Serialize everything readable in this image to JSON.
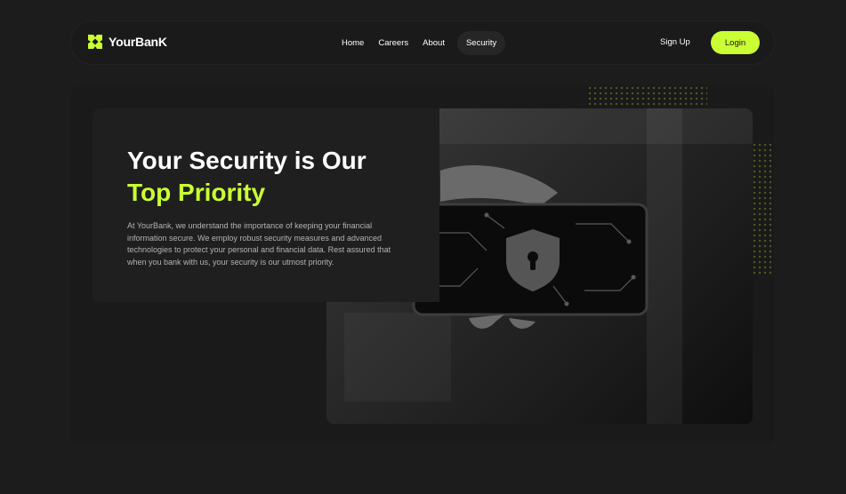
{
  "brand": {
    "name": "YourBanK",
    "accent_color": "#caff33",
    "logo_icon": "brand-logo-icon"
  },
  "nav": {
    "items": [
      {
        "label": "Home",
        "active": false
      },
      {
        "label": "Careers",
        "active": false
      },
      {
        "label": "About",
        "active": false
      },
      {
        "label": "Security",
        "active": true
      }
    ],
    "signup_label": "Sign Up",
    "login_label": "Login"
  },
  "hero": {
    "title_line1": "Your Security is Our",
    "title_line2": "Top Priority",
    "description": "At YourBank, we understand the importance of keeping your financial information secure. We employ robust security measures and advanced technologies to protect your personal and financial data. Rest assured that when you bank with us, your security is our utmost priority.",
    "image_subject": "hand holding smartphone with padlock icon"
  }
}
